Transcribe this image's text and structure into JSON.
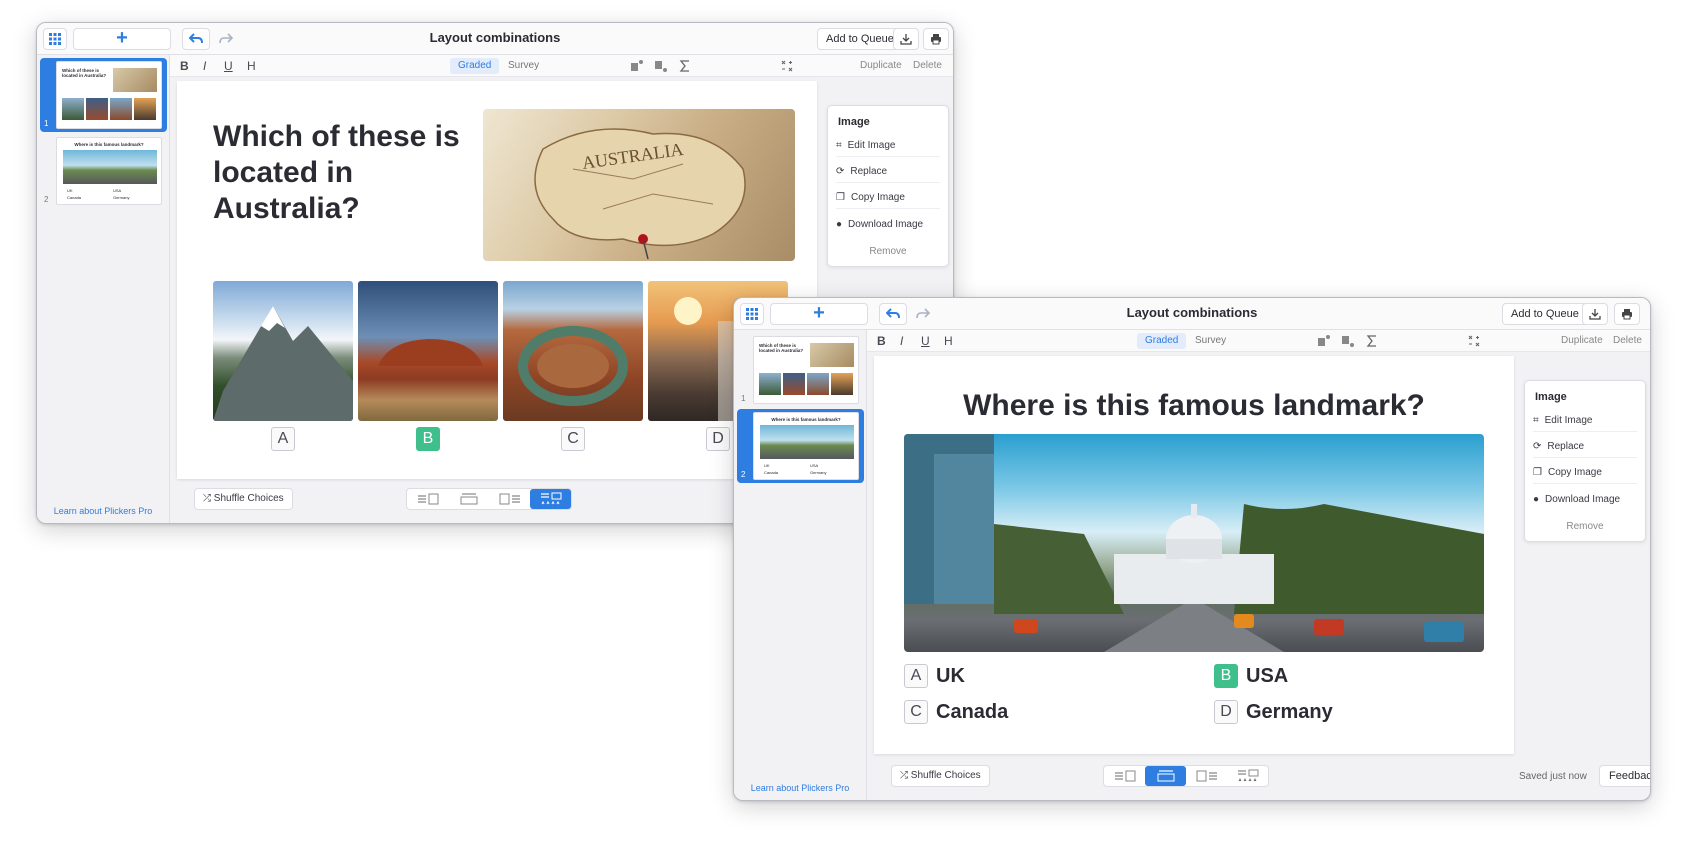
{
  "colors": {
    "accent": "#2e7de0",
    "correct": "#3fbf8c",
    "chrome": "#f2f2f5"
  },
  "window1": {
    "title": "Layout combinations",
    "add_to_queue": "Add to Queue",
    "format": {
      "bold": "B",
      "italic": "I",
      "underline": "U",
      "heading": "H"
    },
    "mode_graded": "Graded",
    "mode_survey": "Survey",
    "duplicate": "Duplicate",
    "delete": "Delete",
    "sidebar": {
      "slides": [
        {
          "number": "1",
          "caption": "Which of these is located in Australia?"
        },
        {
          "number": "2",
          "caption": "Where is this famous landmark?",
          "choices": [
            "UK",
            "USA",
            "Canada",
            "Germany"
          ]
        }
      ],
      "learn_link": "Learn about Plickers Pro"
    },
    "question": "Which of these is located in Australia?",
    "choices": [
      "A",
      "B",
      "C",
      "D"
    ],
    "image_panel": {
      "title": "Image",
      "items": [
        "Edit Image",
        "Replace",
        "Copy Image",
        "Download Image"
      ],
      "remove": "Remove"
    },
    "shuffle": "Shuffle Choices"
  },
  "window2": {
    "title": "Layout combinations",
    "add_to_queue": "Add to Queue",
    "format": {
      "bold": "B",
      "italic": "I",
      "underline": "U",
      "heading": "H"
    },
    "mode_graded": "Graded",
    "mode_survey": "Survey",
    "duplicate": "Duplicate",
    "delete": "Delete",
    "sidebar": {
      "slides": [
        {
          "number": "1",
          "caption": "Which of these is located in Australia?"
        },
        {
          "number": "2",
          "caption": "Where is this famous landmark?",
          "choices": [
            "UK",
            "USA",
            "Canada",
            "Germany"
          ]
        }
      ],
      "learn_link": "Learn about Plickers Pro"
    },
    "question": "Where is this famous landmark?",
    "choices": [
      {
        "letter": "A",
        "text": "UK"
      },
      {
        "letter": "B",
        "text": "USA"
      },
      {
        "letter": "C",
        "text": "Canada"
      },
      {
        "letter": "D",
        "text": "Germany"
      }
    ],
    "image_panel": {
      "title": "Image",
      "items": [
        "Edit Image",
        "Replace",
        "Copy Image",
        "Download Image"
      ],
      "remove": "Remove"
    },
    "shuffle": "Shuffle Choices",
    "saved": "Saved just now",
    "feedback": "Feedback"
  }
}
